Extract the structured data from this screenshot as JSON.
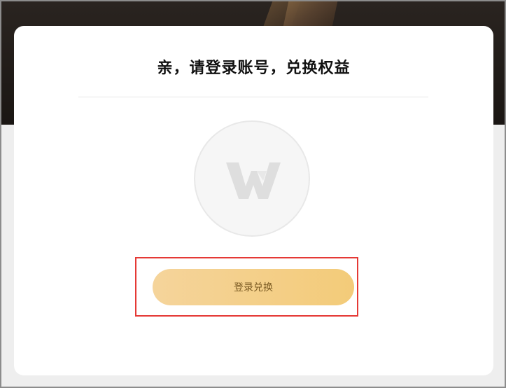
{
  "page": {
    "title": "亲，请登录账号，兑换权益"
  },
  "actions": {
    "login_redeem_label": "登录兑换"
  },
  "icons": {
    "logo": "wps-logo-icon"
  },
  "colors": {
    "button_gradient_start": "#f5d49b",
    "button_gradient_end": "#f3cb79",
    "button_text": "#7a5a23",
    "highlight_border": "#e53935"
  }
}
